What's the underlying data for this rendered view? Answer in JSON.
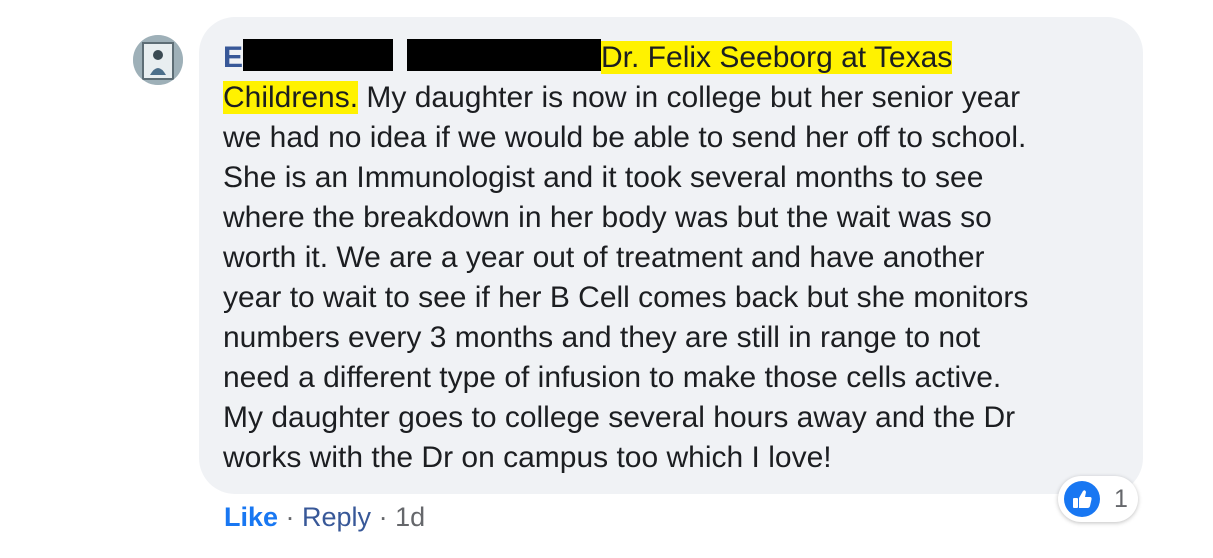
{
  "comment": {
    "author_initial": "E",
    "lines": [
      {
        "highlight": "Dr. Felix Seeborg at Texas "
      },
      {
        "highlight": "Childrens.",
        "rest": " My daughter is now in college but her senior year"
      },
      {
        "rest": "we had no idea if we would be able to send her off to school."
      },
      {
        "rest": "She is an Immunologist and it took several months to see"
      },
      {
        "rest": "where the breakdown in her body was but the wait was so"
      },
      {
        "rest": "worth it. We are a year out of treatment and have another"
      },
      {
        "rest": "year to wait to see if her B Cell comes back but she monitors"
      },
      {
        "rest": "numbers every 3 months and they are still in range to not"
      },
      {
        "rest": "need a different type of infusion to make those cells active."
      },
      {
        "rest": "My daughter goes to college several hours away and the Dr"
      },
      {
        "rest": "works with the Dr on campus too which I love!"
      }
    ]
  },
  "actions": {
    "like": "Like",
    "sep1": " · ",
    "reply": "Reply",
    "sep2": " · ",
    "time": "1d"
  },
  "reactions": {
    "icon": "like-thumb-icon",
    "count": "1"
  },
  "colors": {
    "bubble": "#f0f2f5",
    "highlight": "#fff200",
    "like_blue": "#1877f2"
  }
}
